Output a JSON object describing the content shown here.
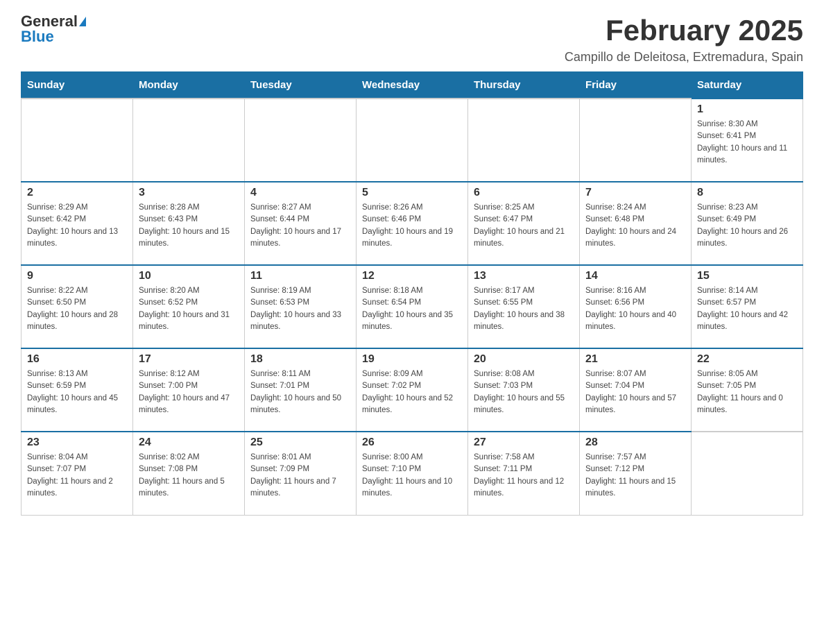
{
  "header": {
    "logo_general": "General",
    "logo_blue": "Blue",
    "month_title": "February 2025",
    "location": "Campillo de Deleitosa, Extremadura, Spain"
  },
  "weekdays": [
    "Sunday",
    "Monday",
    "Tuesday",
    "Wednesday",
    "Thursday",
    "Friday",
    "Saturday"
  ],
  "weeks": [
    [
      {
        "day": "",
        "info": ""
      },
      {
        "day": "",
        "info": ""
      },
      {
        "day": "",
        "info": ""
      },
      {
        "day": "",
        "info": ""
      },
      {
        "day": "",
        "info": ""
      },
      {
        "day": "",
        "info": ""
      },
      {
        "day": "1",
        "info": "Sunrise: 8:30 AM\nSunset: 6:41 PM\nDaylight: 10 hours and 11 minutes."
      }
    ],
    [
      {
        "day": "2",
        "info": "Sunrise: 8:29 AM\nSunset: 6:42 PM\nDaylight: 10 hours and 13 minutes."
      },
      {
        "day": "3",
        "info": "Sunrise: 8:28 AM\nSunset: 6:43 PM\nDaylight: 10 hours and 15 minutes."
      },
      {
        "day": "4",
        "info": "Sunrise: 8:27 AM\nSunset: 6:44 PM\nDaylight: 10 hours and 17 minutes."
      },
      {
        "day": "5",
        "info": "Sunrise: 8:26 AM\nSunset: 6:46 PM\nDaylight: 10 hours and 19 minutes."
      },
      {
        "day": "6",
        "info": "Sunrise: 8:25 AM\nSunset: 6:47 PM\nDaylight: 10 hours and 21 minutes."
      },
      {
        "day": "7",
        "info": "Sunrise: 8:24 AM\nSunset: 6:48 PM\nDaylight: 10 hours and 24 minutes."
      },
      {
        "day": "8",
        "info": "Sunrise: 8:23 AM\nSunset: 6:49 PM\nDaylight: 10 hours and 26 minutes."
      }
    ],
    [
      {
        "day": "9",
        "info": "Sunrise: 8:22 AM\nSunset: 6:50 PM\nDaylight: 10 hours and 28 minutes."
      },
      {
        "day": "10",
        "info": "Sunrise: 8:20 AM\nSunset: 6:52 PM\nDaylight: 10 hours and 31 minutes."
      },
      {
        "day": "11",
        "info": "Sunrise: 8:19 AM\nSunset: 6:53 PM\nDaylight: 10 hours and 33 minutes."
      },
      {
        "day": "12",
        "info": "Sunrise: 8:18 AM\nSunset: 6:54 PM\nDaylight: 10 hours and 35 minutes."
      },
      {
        "day": "13",
        "info": "Sunrise: 8:17 AM\nSunset: 6:55 PM\nDaylight: 10 hours and 38 minutes."
      },
      {
        "day": "14",
        "info": "Sunrise: 8:16 AM\nSunset: 6:56 PM\nDaylight: 10 hours and 40 minutes."
      },
      {
        "day": "15",
        "info": "Sunrise: 8:14 AM\nSunset: 6:57 PM\nDaylight: 10 hours and 42 minutes."
      }
    ],
    [
      {
        "day": "16",
        "info": "Sunrise: 8:13 AM\nSunset: 6:59 PM\nDaylight: 10 hours and 45 minutes."
      },
      {
        "day": "17",
        "info": "Sunrise: 8:12 AM\nSunset: 7:00 PM\nDaylight: 10 hours and 47 minutes."
      },
      {
        "day": "18",
        "info": "Sunrise: 8:11 AM\nSunset: 7:01 PM\nDaylight: 10 hours and 50 minutes."
      },
      {
        "day": "19",
        "info": "Sunrise: 8:09 AM\nSunset: 7:02 PM\nDaylight: 10 hours and 52 minutes."
      },
      {
        "day": "20",
        "info": "Sunrise: 8:08 AM\nSunset: 7:03 PM\nDaylight: 10 hours and 55 minutes."
      },
      {
        "day": "21",
        "info": "Sunrise: 8:07 AM\nSunset: 7:04 PM\nDaylight: 10 hours and 57 minutes."
      },
      {
        "day": "22",
        "info": "Sunrise: 8:05 AM\nSunset: 7:05 PM\nDaylight: 11 hours and 0 minutes."
      }
    ],
    [
      {
        "day": "23",
        "info": "Sunrise: 8:04 AM\nSunset: 7:07 PM\nDaylight: 11 hours and 2 minutes."
      },
      {
        "day": "24",
        "info": "Sunrise: 8:02 AM\nSunset: 7:08 PM\nDaylight: 11 hours and 5 minutes."
      },
      {
        "day": "25",
        "info": "Sunrise: 8:01 AM\nSunset: 7:09 PM\nDaylight: 11 hours and 7 minutes."
      },
      {
        "day": "26",
        "info": "Sunrise: 8:00 AM\nSunset: 7:10 PM\nDaylight: 11 hours and 10 minutes."
      },
      {
        "day": "27",
        "info": "Sunrise: 7:58 AM\nSunset: 7:11 PM\nDaylight: 11 hours and 12 minutes."
      },
      {
        "day": "28",
        "info": "Sunrise: 7:57 AM\nSunset: 7:12 PM\nDaylight: 11 hours and 15 minutes."
      },
      {
        "day": "",
        "info": ""
      }
    ]
  ]
}
